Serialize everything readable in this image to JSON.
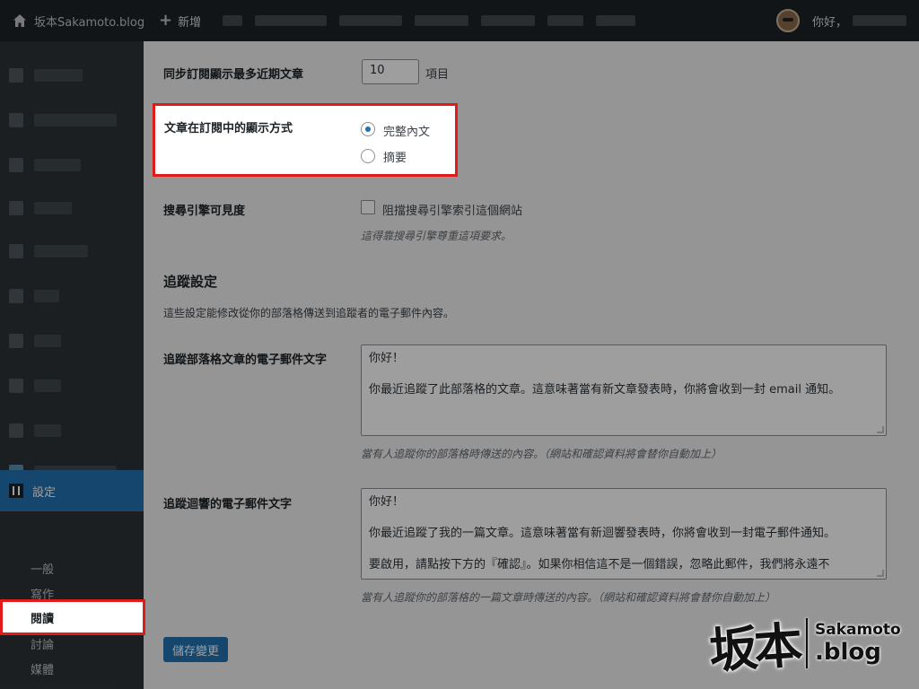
{
  "topbar": {
    "site_name": "坂本Sakamoto.blog",
    "new_label": "新增",
    "greeting": "你好，"
  },
  "sidebar": {
    "settings_label": "設定",
    "submenu": [
      "一般",
      "寫作",
      "閱讀",
      "討論",
      "媒體"
    ],
    "active": "閱讀"
  },
  "reading": {
    "recent_posts_label": "同步訂閱顯示最多近期文章",
    "recent_posts_value": "10",
    "recent_posts_unit": "項目",
    "display_mode_label": "文章在訂閱中的顯示方式",
    "display_options": [
      "完整內文",
      "摘要"
    ],
    "display_selected": "完整內文",
    "search_visibility_label": "搜尋引擎可見度",
    "search_checkbox_label": "阻擋搜尋引擎索引這個網站",
    "search_hint": "這得靠搜尋引擎尊重這項要求。"
  },
  "follow": {
    "heading": "追蹤設定",
    "intro": "這些設定能修改從你的部落格傳送到追蹤者的電子郵件內容。",
    "blog_email_label": "追蹤部落格文章的電子郵件文字",
    "blog_email_lines": [
      "你好！",
      "",
      "你最近追蹤了此部落格的文章。這意味著當有新文章發表時，你將會收到一封 email 通知。"
    ],
    "blog_email_hint": "當有人追蹤你的部落格時傳送的內容。（網站和確認資料將會替你自動加上）",
    "comment_email_label": "追蹤迴響的電子郵件文字",
    "comment_email_lines": [
      "你好！",
      "",
      "你最近追蹤了我的一篇文章。這意味著當有新迴響發表時，你將會收到一封電子郵件通知。",
      "",
      "要啟用，請點按下方的『確認』。如果你相信這不是一個錯誤，忽略此郵件，我們將永遠不"
    ],
    "comment_email_hint": "當有人追蹤你的部落格的一篇文章時傳送的內容。（網站和確認資料將會替你自動加上）"
  },
  "save_label": "儲存變更",
  "watermark": {
    "big": "坂本",
    "small_top": "Sakamoto",
    "small_bottom": ".blog"
  }
}
